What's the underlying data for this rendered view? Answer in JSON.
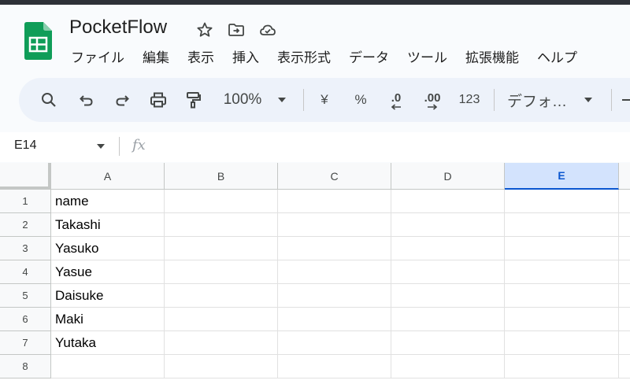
{
  "app": {
    "title": "PocketFlow",
    "brand_color": "#0f9d58"
  },
  "menu": [
    "ファイル",
    "編集",
    "表示",
    "挿入",
    "表示形式",
    "データ",
    "ツール",
    "拡張機能",
    "ヘルプ"
  ],
  "toolbar": {
    "zoom": "100%",
    "currency": "¥",
    "percent": "%",
    "decrease_decimal": ".0",
    "increase_decimal": ".00",
    "number_format": "123",
    "font": "デフォ…"
  },
  "formula_bar": {
    "name_box": "E14",
    "fx_label": "fx",
    "value": ""
  },
  "sheet": {
    "columns": [
      "A",
      "B",
      "C",
      "D",
      "E"
    ],
    "selected_column": "E",
    "rows": [
      "1",
      "2",
      "3",
      "4",
      "5",
      "6",
      "7",
      "8"
    ],
    "column_a_values": [
      "name",
      "Takashi",
      "Yasuko",
      "Yasue",
      "Daisuke",
      "Maki",
      "Yutaka",
      ""
    ]
  },
  "colors": {
    "selected_header": "#d3e3fd",
    "accent": "#0b57d0",
    "toolbar_bg": "#edf2fa"
  }
}
